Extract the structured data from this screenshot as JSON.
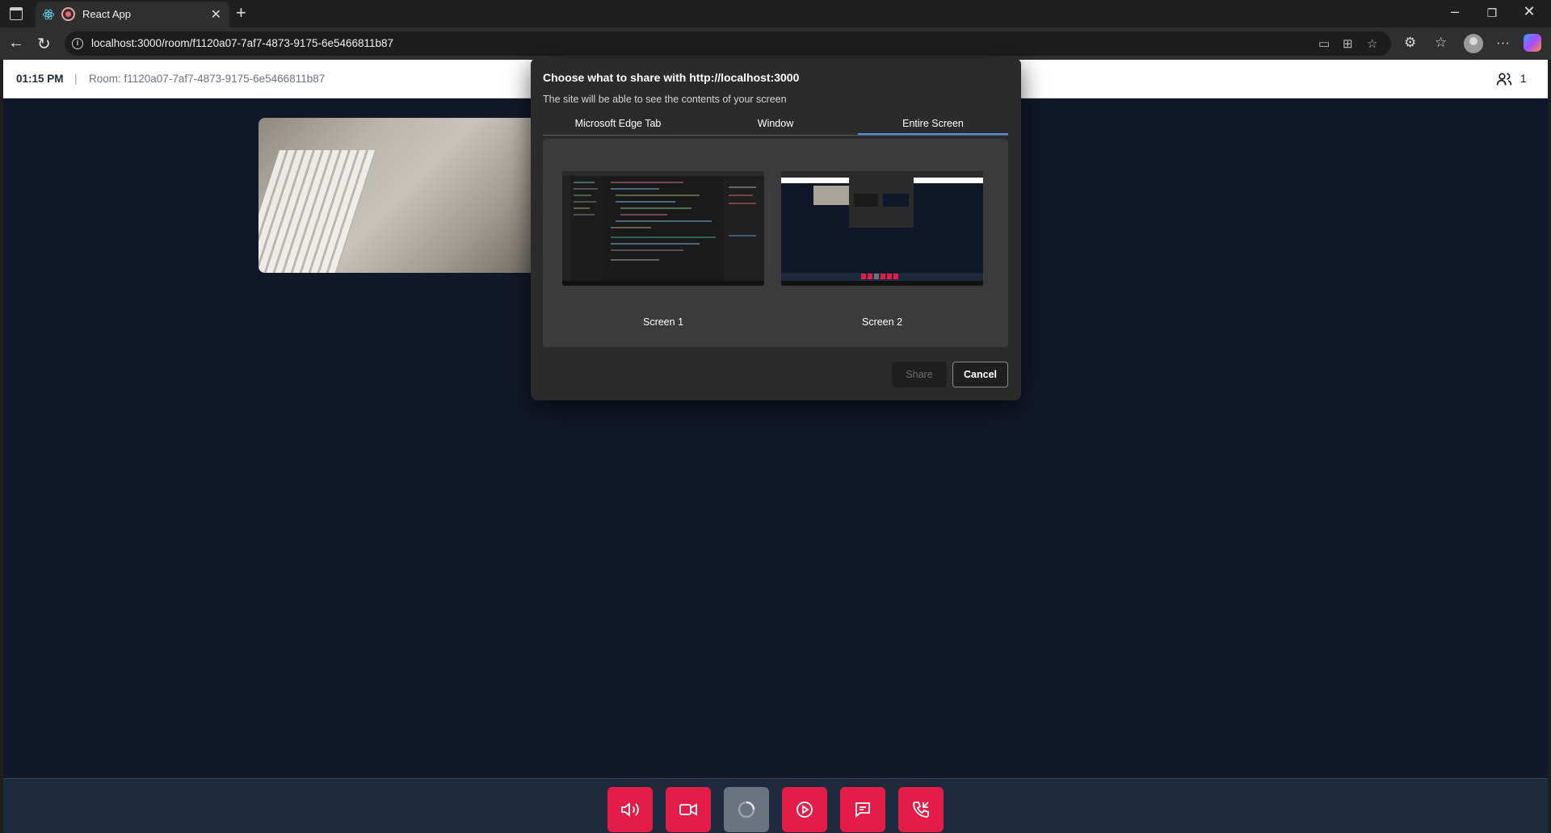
{
  "browser": {
    "tab_title": "React App",
    "url": "localhost:3000/room/f1120a07-7af7-4873-9175-6e5466811b87"
  },
  "header": {
    "time": "01:15 PM",
    "separator": "|",
    "room": "Room: f1120a07-7af7-4873-9175-6e5466811b87",
    "participant_count": "1"
  },
  "dialog": {
    "title": "Choose what to share with http://localhost:3000",
    "subtitle": "The site will be able to see the contents of your screen",
    "tabs": [
      "Microsoft Edge Tab",
      "Window",
      "Entire Screen"
    ],
    "active_tab": "Entire Screen",
    "screens": [
      "Screen 1",
      "Screen 2"
    ],
    "share_label": "Share",
    "cancel_label": "Cancel"
  },
  "controls": {
    "buttons": [
      "speaker-icon",
      "video-camera-icon",
      "loading-spinner-icon",
      "record-icon",
      "chat-icon",
      "end-call-icon"
    ],
    "accent": "#e11d48",
    "busy": "#6b7280"
  },
  "colors": {
    "page_bg": "#111827",
    "accent_blue": "#4f8ff7"
  }
}
